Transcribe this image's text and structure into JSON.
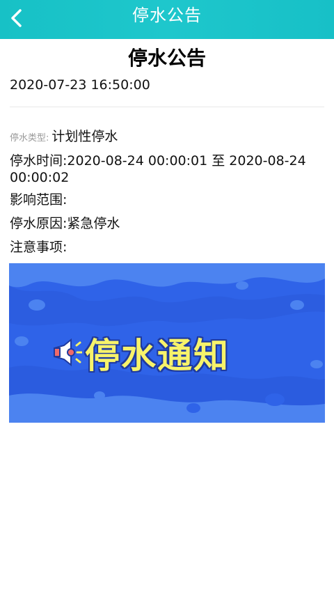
{
  "header": {
    "title": "停水公告",
    "back_icon": "back-arrow-icon"
  },
  "article": {
    "title": "停水公告",
    "publish_time": "2020-07-23 16:50:00",
    "type_label": "停水类型:",
    "type_value": "计划性停水",
    "time_label": "停水时间:",
    "time_value": "2020-08-24 00:00:01 至 2020-08-24 00:00:02",
    "scope_label": "影响范围:",
    "scope_value": "",
    "reason_label": "停水原因:",
    "reason_value": "紧急停水",
    "notice_label": "注意事项:",
    "notice_value": ""
  },
  "banner": {
    "text": "停水通知",
    "icon": "megaphone-icon",
    "colors": {
      "background": "#2f63e8",
      "wave_light": "#4c83f0",
      "wave_dark": "#2a59d9",
      "text": "#f7f36a"
    }
  },
  "colors": {
    "header_bg": "#1ec7cc",
    "header_text": "#ffffff"
  }
}
